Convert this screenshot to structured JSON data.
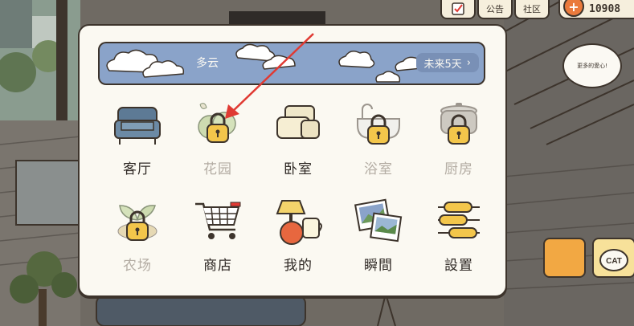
{
  "hud": {
    "notice_label": "公告",
    "community_label": "社区",
    "coins": "10908",
    "plus_symbol": "+"
  },
  "bubble_text": "更多的愛心!",
  "weather": {
    "label": "多云",
    "forecast_label": "未来5天",
    "forecast_chevron": "›"
  },
  "rooms": [
    {
      "label": "客厅",
      "icon": "sofa-icon",
      "locked": false
    },
    {
      "label": "花园",
      "icon": "garden-icon",
      "locked": true
    },
    {
      "label": "卧室",
      "icon": "bed-icon",
      "locked": false
    },
    {
      "label": "浴室",
      "icon": "bathtub-icon",
      "locked": true
    },
    {
      "label": "厨房",
      "icon": "pot-icon",
      "locked": true
    },
    {
      "label": "农场",
      "icon": "sprout-icon",
      "locked": true
    },
    {
      "label": "商店",
      "icon": "cart-icon",
      "locked": false
    },
    {
      "label": "我的",
      "icon": "lamp-icon",
      "locked": false
    },
    {
      "label": "瞬間",
      "icon": "photos-icon",
      "locked": false
    },
    {
      "label": "設置",
      "icon": "sliders-icon",
      "locked": false
    }
  ],
  "cat_box_label": "CAT",
  "colors": {
    "panel_bg": "#fbf9f2",
    "weather_bar": "#8aa3c9",
    "lock_yellow": "#f3c64b",
    "arrow_red": "#e03a33",
    "outline": "#3d342c"
  }
}
